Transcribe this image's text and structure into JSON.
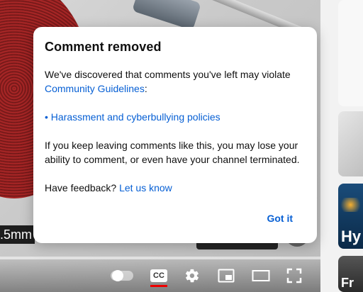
{
  "dialog": {
    "title": "Comment removed",
    "intro": "We've discovered that comments you've left may violate",
    "guidelines_link": "Community Guidelines",
    "guidelines_suffix": ":",
    "policy_link": "• Harassment and cyberbullying policies",
    "warning": "If you keep leaving comments like this, you may lose your ability to comment, or even have your channel terminated.",
    "feedback_prefix": "Have feedback?",
    "feedback_link": "Let us know",
    "confirm_label": "Got it"
  },
  "player": {
    "overlay_text": ".5mm",
    "cc_label": "CC",
    "icons": [
      "autoplay-toggle-icon",
      "captions-icon",
      "settings-gear-icon",
      "miniplayer-icon",
      "theater-mode-icon",
      "fullscreen-icon"
    ]
  },
  "sidebar": {
    "thumb3_text": "Hy",
    "thumb4_text": "Fr"
  },
  "colors": {
    "link": "#065fd4",
    "caption_underline": "#e00000"
  }
}
